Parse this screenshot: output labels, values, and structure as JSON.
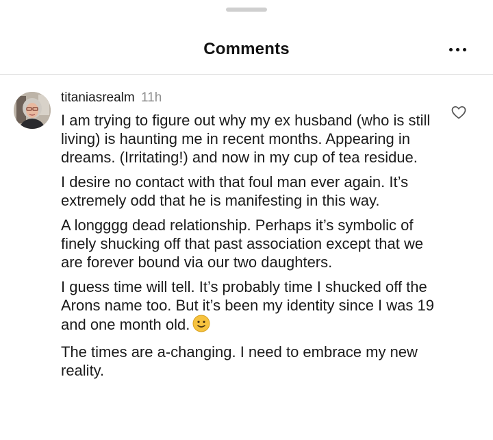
{
  "header": {
    "title": "Comments"
  },
  "icons": {
    "more": "more-horizontal-icon",
    "like": "heart-outline-icon",
    "emoji": "slightly-smiling-face-emoji",
    "avatar": "user-avatar-photo"
  },
  "colors": {
    "text": "#111111",
    "secondary_text": "#8e8e8e",
    "divider": "#e2e2e2",
    "handle": "#cfcfcf",
    "emoji": "#f6c23e"
  },
  "comment": {
    "username": "titaniasrealm",
    "timestamp": "11h",
    "paragraphs": [
      "I am trying to figure out why my ex husband (who is still living) is haunting me in recent months. Appearing in dreams. (Irritating!) and now in my cup of tea residue.",
      "I desire no contact with that foul man ever again. It’s extremely odd that he is manifesting in this way.",
      "A longggg dead relationship.  Perhaps it’s symbolic of finely shucking off that past association except that we are forever bound via our two daughters.",
      "I guess time will tell.  It’s probably time I shucked off the Arons name too. But it’s been my identity since I was 19 and one month old.",
      "The times are a-changing.  I need to embrace my new reality."
    ]
  }
}
